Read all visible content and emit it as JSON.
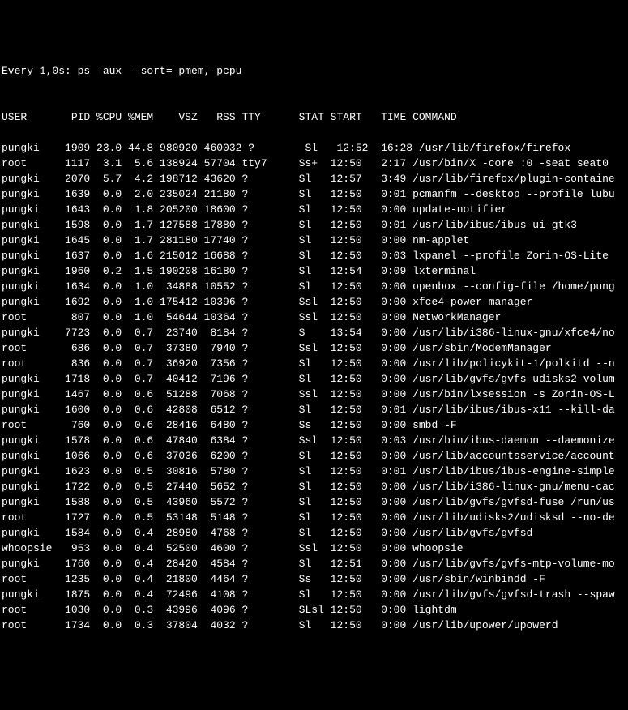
{
  "header": "Every 1,0s: ps -aux --sort=-pmem,-pcpu",
  "columns": [
    "USER",
    "PID",
    "%CPU",
    "%MEM",
    "VSZ",
    "RSS",
    "TTY",
    "STAT",
    "START",
    "TIME",
    "COMMAND"
  ],
  "columnHeaderLine": "USER       PID %CPU %MEM    VSZ   RSS TTY      STAT START   TIME COMMAND",
  "rows": [
    {
      "user": "pungki",
      "pid": "1909",
      "cpu": "23.0",
      "mem": "44.8",
      "vsz": "980920",
      "rss": "460032",
      "tty": "?",
      "stat": "Sl",
      "start": "12:52",
      "time": "16:28",
      "command": "/usr/lib/firefox/firefox"
    },
    {
      "user": "root",
      "pid": "1117",
      "cpu": "3.1",
      "mem": "5.6",
      "vsz": "138924",
      "rss": "57704",
      "tty": "tty7",
      "stat": "Ss+",
      "start": "12:50",
      "time": "2:17",
      "command": "/usr/bin/X -core :0 -seat seat0"
    },
    {
      "user": "pungki",
      "pid": "2070",
      "cpu": "5.7",
      "mem": "4.2",
      "vsz": "198712",
      "rss": "43620",
      "tty": "?",
      "stat": "Sl",
      "start": "12:57",
      "time": "3:49",
      "command": "/usr/lib/firefox/plugin-containe"
    },
    {
      "user": "pungki",
      "pid": "1639",
      "cpu": "0.0",
      "mem": "2.0",
      "vsz": "235024",
      "rss": "21180",
      "tty": "?",
      "stat": "Sl",
      "start": "12:50",
      "time": "0:01",
      "command": "pcmanfm --desktop --profile lubu"
    },
    {
      "user": "pungki",
      "pid": "1643",
      "cpu": "0.0",
      "mem": "1.8",
      "vsz": "205200",
      "rss": "18600",
      "tty": "?",
      "stat": "Sl",
      "start": "12:50",
      "time": "0:00",
      "command": "update-notifier"
    },
    {
      "user": "pungki",
      "pid": "1598",
      "cpu": "0.0",
      "mem": "1.7",
      "vsz": "127588",
      "rss": "17880",
      "tty": "?",
      "stat": "Sl",
      "start": "12:50",
      "time": "0:01",
      "command": "/usr/lib/ibus/ibus-ui-gtk3"
    },
    {
      "user": "pungki",
      "pid": "1645",
      "cpu": "0.0",
      "mem": "1.7",
      "vsz": "281180",
      "rss": "17740",
      "tty": "?",
      "stat": "Sl",
      "start": "12:50",
      "time": "0:00",
      "command": "nm-applet"
    },
    {
      "user": "pungki",
      "pid": "1637",
      "cpu": "0.0",
      "mem": "1.6",
      "vsz": "215012",
      "rss": "16688",
      "tty": "?",
      "stat": "Sl",
      "start": "12:50",
      "time": "0:03",
      "command": "lxpanel --profile Zorin-OS-Lite"
    },
    {
      "user": "pungki",
      "pid": "1960",
      "cpu": "0.2",
      "mem": "1.5",
      "vsz": "190208",
      "rss": "16180",
      "tty": "?",
      "stat": "Sl",
      "start": "12:54",
      "time": "0:09",
      "command": "lxterminal"
    },
    {
      "user": "pungki",
      "pid": "1634",
      "cpu": "0.0",
      "mem": "1.0",
      "vsz": "34888",
      "rss": "10552",
      "tty": "?",
      "stat": "Sl",
      "start": "12:50",
      "time": "0:00",
      "command": "openbox --config-file /home/pung"
    },
    {
      "user": "pungki",
      "pid": "1692",
      "cpu": "0.0",
      "mem": "1.0",
      "vsz": "175412",
      "rss": "10396",
      "tty": "?",
      "stat": "Ssl",
      "start": "12:50",
      "time": "0:00",
      "command": "xfce4-power-manager"
    },
    {
      "user": "root",
      "pid": "807",
      "cpu": "0.0",
      "mem": "1.0",
      "vsz": "54644",
      "rss": "10364",
      "tty": "?",
      "stat": "Ssl",
      "start": "12:50",
      "time": "0:00",
      "command": "NetworkManager"
    },
    {
      "user": "pungki",
      "pid": "7723",
      "cpu": "0.0",
      "mem": "0.7",
      "vsz": "23740",
      "rss": "8184",
      "tty": "?",
      "stat": "S",
      "start": "13:54",
      "time": "0:00",
      "command": "/usr/lib/i386-linux-gnu/xfce4/no"
    },
    {
      "user": "root",
      "pid": "686",
      "cpu": "0.0",
      "mem": "0.7",
      "vsz": "37380",
      "rss": "7940",
      "tty": "?",
      "stat": "Ssl",
      "start": "12:50",
      "time": "0:00",
      "command": "/usr/sbin/ModemManager"
    },
    {
      "user": "root",
      "pid": "836",
      "cpu": "0.0",
      "mem": "0.7",
      "vsz": "36920",
      "rss": "7356",
      "tty": "?",
      "stat": "Sl",
      "start": "12:50",
      "time": "0:00",
      "command": "/usr/lib/policykit-1/polkitd --n"
    },
    {
      "user": "pungki",
      "pid": "1718",
      "cpu": "0.0",
      "mem": "0.7",
      "vsz": "40412",
      "rss": "7196",
      "tty": "?",
      "stat": "Sl",
      "start": "12:50",
      "time": "0:00",
      "command": "/usr/lib/gvfs/gvfs-udisks2-volum"
    },
    {
      "user": "pungki",
      "pid": "1467",
      "cpu": "0.0",
      "mem": "0.6",
      "vsz": "51288",
      "rss": "7068",
      "tty": "?",
      "stat": "Ssl",
      "start": "12:50",
      "time": "0:00",
      "command": "/usr/bin/lxsession -s Zorin-OS-L"
    },
    {
      "user": "pungki",
      "pid": "1600",
      "cpu": "0.0",
      "mem": "0.6",
      "vsz": "42808",
      "rss": "6512",
      "tty": "?",
      "stat": "Sl",
      "start": "12:50",
      "time": "0:01",
      "command": "/usr/lib/ibus/ibus-x11 --kill-da"
    },
    {
      "user": "root",
      "pid": "760",
      "cpu": "0.0",
      "mem": "0.6",
      "vsz": "28416",
      "rss": "6480",
      "tty": "?",
      "stat": "Ss",
      "start": "12:50",
      "time": "0:00",
      "command": "smbd -F"
    },
    {
      "user": "pungki",
      "pid": "1578",
      "cpu": "0.0",
      "mem": "0.6",
      "vsz": "47840",
      "rss": "6384",
      "tty": "?",
      "stat": "Ssl",
      "start": "12:50",
      "time": "0:03",
      "command": "/usr/bin/ibus-daemon --daemonize"
    },
    {
      "user": "pungki",
      "pid": "1066",
      "cpu": "0.0",
      "mem": "0.6",
      "vsz": "37036",
      "rss": "6200",
      "tty": "?",
      "stat": "Sl",
      "start": "12:50",
      "time": "0:00",
      "command": "/usr/lib/accountsservice/account"
    },
    {
      "user": "pungki",
      "pid": "1623",
      "cpu": "0.0",
      "mem": "0.5",
      "vsz": "30816",
      "rss": "5780",
      "tty": "?",
      "stat": "Sl",
      "start": "12:50",
      "time": "0:01",
      "command": "/usr/lib/ibus/ibus-engine-simple"
    },
    {
      "user": "pungki",
      "pid": "1722",
      "cpu": "0.0",
      "mem": "0.5",
      "vsz": "27440",
      "rss": "5652",
      "tty": "?",
      "stat": "Sl",
      "start": "12:50",
      "time": "0:00",
      "command": "/usr/lib/i386-linux-gnu/menu-cac"
    },
    {
      "user": "pungki",
      "pid": "1588",
      "cpu": "0.0",
      "mem": "0.5",
      "vsz": "43960",
      "rss": "5572",
      "tty": "?",
      "stat": "Sl",
      "start": "12:50",
      "time": "0:00",
      "command": "/usr/lib/gvfs/gvfsd-fuse /run/us"
    },
    {
      "user": "root",
      "pid": "1727",
      "cpu": "0.0",
      "mem": "0.5",
      "vsz": "53148",
      "rss": "5148",
      "tty": "?",
      "stat": "Sl",
      "start": "12:50",
      "time": "0:00",
      "command": "/usr/lib/udisks2/udisksd --no-de"
    },
    {
      "user": "pungki",
      "pid": "1584",
      "cpu": "0.0",
      "mem": "0.4",
      "vsz": "28980",
      "rss": "4768",
      "tty": "?",
      "stat": "Sl",
      "start": "12:50",
      "time": "0:00",
      "command": "/usr/lib/gvfs/gvfsd"
    },
    {
      "user": "whoopsie",
      "pid": "953",
      "cpu": "0.0",
      "mem": "0.4",
      "vsz": "52500",
      "rss": "4600",
      "tty": "?",
      "stat": "Ssl",
      "start": "12:50",
      "time": "0:00",
      "command": "whoopsie"
    },
    {
      "user": "pungki",
      "pid": "1760",
      "cpu": "0.0",
      "mem": "0.4",
      "vsz": "28420",
      "rss": "4584",
      "tty": "?",
      "stat": "Sl",
      "start": "12:51",
      "time": "0:00",
      "command": "/usr/lib/gvfs/gvfs-mtp-volume-mo"
    },
    {
      "user": "root",
      "pid": "1235",
      "cpu": "0.0",
      "mem": "0.4",
      "vsz": "21800",
      "rss": "4464",
      "tty": "?",
      "stat": "Ss",
      "start": "12:50",
      "time": "0:00",
      "command": "/usr/sbin/winbindd -F"
    },
    {
      "user": "pungki",
      "pid": "1875",
      "cpu": "0.0",
      "mem": "0.4",
      "vsz": "72496",
      "rss": "4108",
      "tty": "?",
      "stat": "Sl",
      "start": "12:50",
      "time": "0:00",
      "command": "/usr/lib/gvfs/gvfsd-trash --spaw"
    },
    {
      "user": "root",
      "pid": "1030",
      "cpu": "0.0",
      "mem": "0.3",
      "vsz": "43996",
      "rss": "4096",
      "tty": "?",
      "stat": "SLsl",
      "start": "12:50",
      "time": "0:00",
      "command": "lightdm"
    },
    {
      "user": "root",
      "pid": "1734",
      "cpu": "0.0",
      "mem": "0.3",
      "vsz": "37804",
      "rss": "4032",
      "tty": "?",
      "stat": "Sl",
      "start": "12:50",
      "time": "0:00",
      "command": "/usr/lib/upower/upowerd"
    }
  ]
}
